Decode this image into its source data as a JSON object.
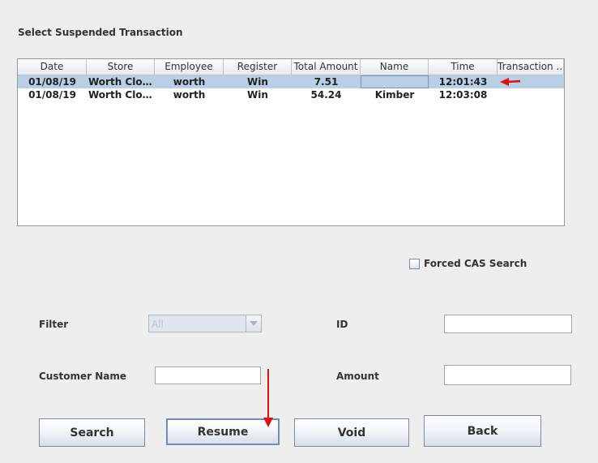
{
  "heading": "Select Suspended Transaction",
  "table": {
    "columns": [
      "Date",
      "Store",
      "Employee",
      "Register",
      "Total Amount",
      "Name",
      "Time",
      "Transaction ..."
    ],
    "rows": [
      {
        "date": "01/08/19",
        "store": "Worth Clot...",
        "employee": "worth",
        "register": "Win",
        "total": "7.51",
        "name": "",
        "time": "12:01:43",
        "transaction": ""
      },
      {
        "date": "01/08/19",
        "store": "Worth Clot...",
        "employee": "worth",
        "register": "Win",
        "total": "54.24",
        "name": "Kimber",
        "time": "12:03:08",
        "transaction": ""
      }
    ]
  },
  "options": {
    "forced_cas_label": "Forced CAS Search",
    "forced_cas_checked": false
  },
  "filters": {
    "filter_label": "Filter",
    "filter_value": "All",
    "id_label": "ID",
    "id_value": "",
    "customer_name_label": "Customer Name",
    "customer_name_value": "",
    "amount_label": "Amount",
    "amount_value": ""
  },
  "buttons": {
    "search": "Search",
    "resume": "Resume",
    "void": "Void",
    "back": "Back"
  },
  "colors": {
    "selection": "#b8cfe5",
    "annotation_arrow": "#e01010"
  },
  "icons": [
    "chevron-down-icon",
    "red-arrow-annotation"
  ]
}
